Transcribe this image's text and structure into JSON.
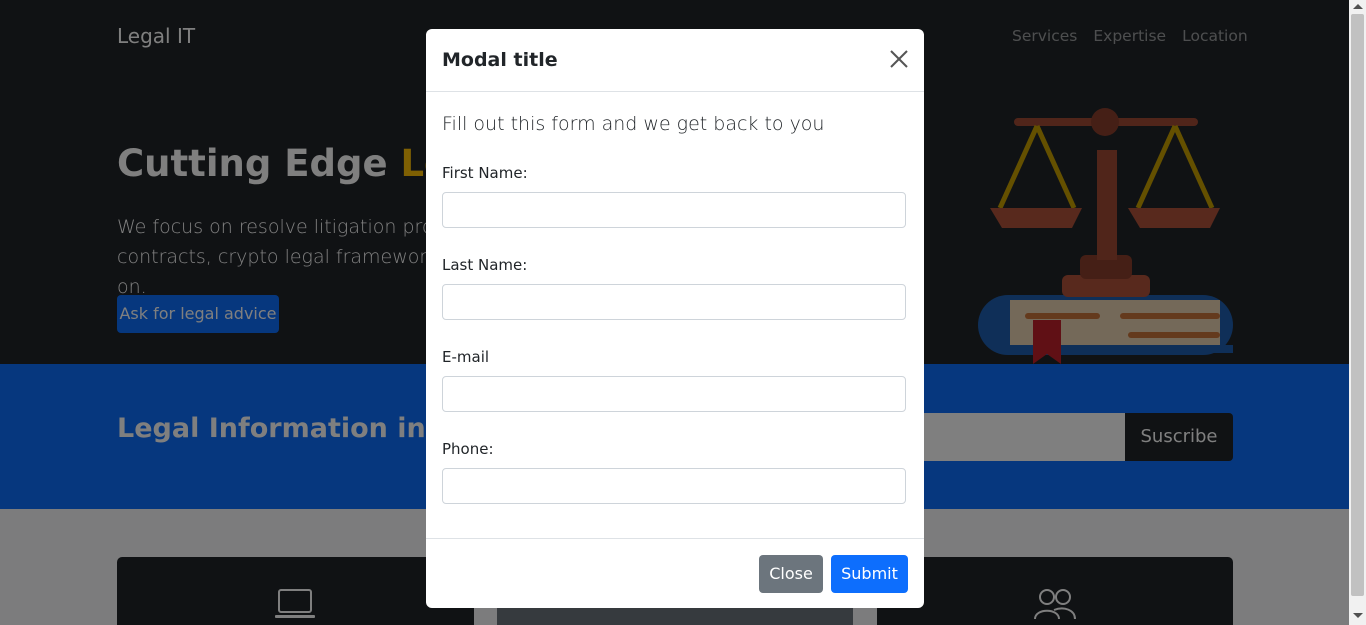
{
  "brand": "Legal IT",
  "nav": {
    "items": [
      "Services",
      "Expertise",
      "Location"
    ]
  },
  "hero": {
    "headline_main": "Cutting Edge ",
    "headline_accent": "Leg",
    "lead_line1": "We focus on resolve litigation probler",
    "lead_line2": "contracts, crypto legal framework, int",
    "lead_line2_tail": "on.",
    "cta_label": "Ask for legal advice"
  },
  "subscribe": {
    "title": "Legal Information in you",
    "button_label": "Suscribe"
  },
  "modal": {
    "title": "Modal title",
    "intro": "Fill out this form and we get back to you",
    "fields": {
      "first_name": {
        "label": "First Name:",
        "value": ""
      },
      "last_name": {
        "label": "Last Name:",
        "value": ""
      },
      "email": {
        "label": "E-mail",
        "value": ""
      },
      "phone": {
        "label": "Phone:",
        "value": ""
      }
    },
    "close_label": "Close",
    "submit_label": "Submit"
  },
  "icons": [
    "close-icon",
    "laptop-icon",
    "people-icon",
    "scales-of-justice-illustration"
  ],
  "colors": {
    "dark": "#212529",
    "primary": "#0d6efd",
    "accent": "#ffc107",
    "secondary": "#6c757d"
  }
}
